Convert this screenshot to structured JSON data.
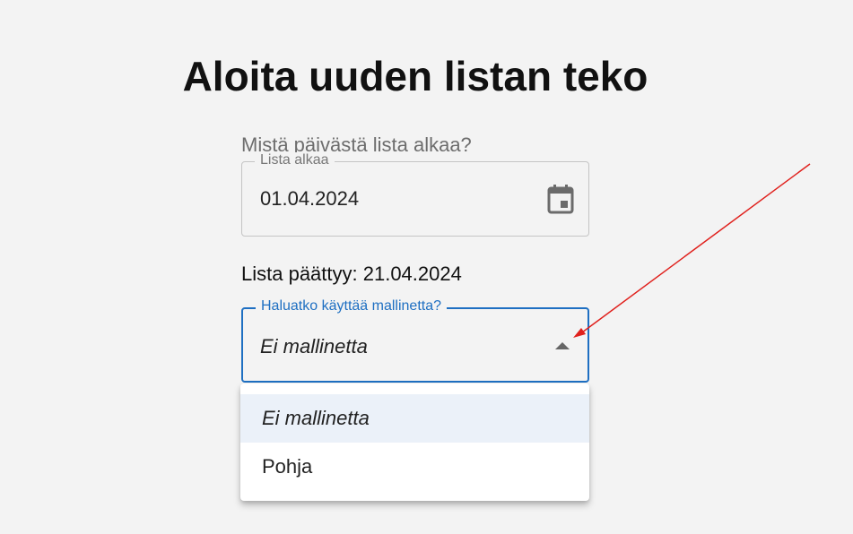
{
  "page": {
    "title": "Aloita uuden listan teko"
  },
  "start_date": {
    "question": "Mistä päivästä lista alkaa?",
    "label": "Lista alkaa",
    "value": "01.04.2024",
    "icon": "calendar-icon"
  },
  "end_date": {
    "text": "Lista päättyy: 21.04.2024"
  },
  "template_select": {
    "label": "Haluatko käyttää mallinetta?",
    "selected_value": "Ei mallinetta",
    "icon": "arrow-up-icon",
    "accent_color": "#1e6fc2",
    "options": [
      {
        "label": "Ei mallinetta",
        "selected": true
      },
      {
        "label": "Pohja",
        "selected": false
      }
    ]
  },
  "annotation": {
    "color": "#e0201c"
  }
}
